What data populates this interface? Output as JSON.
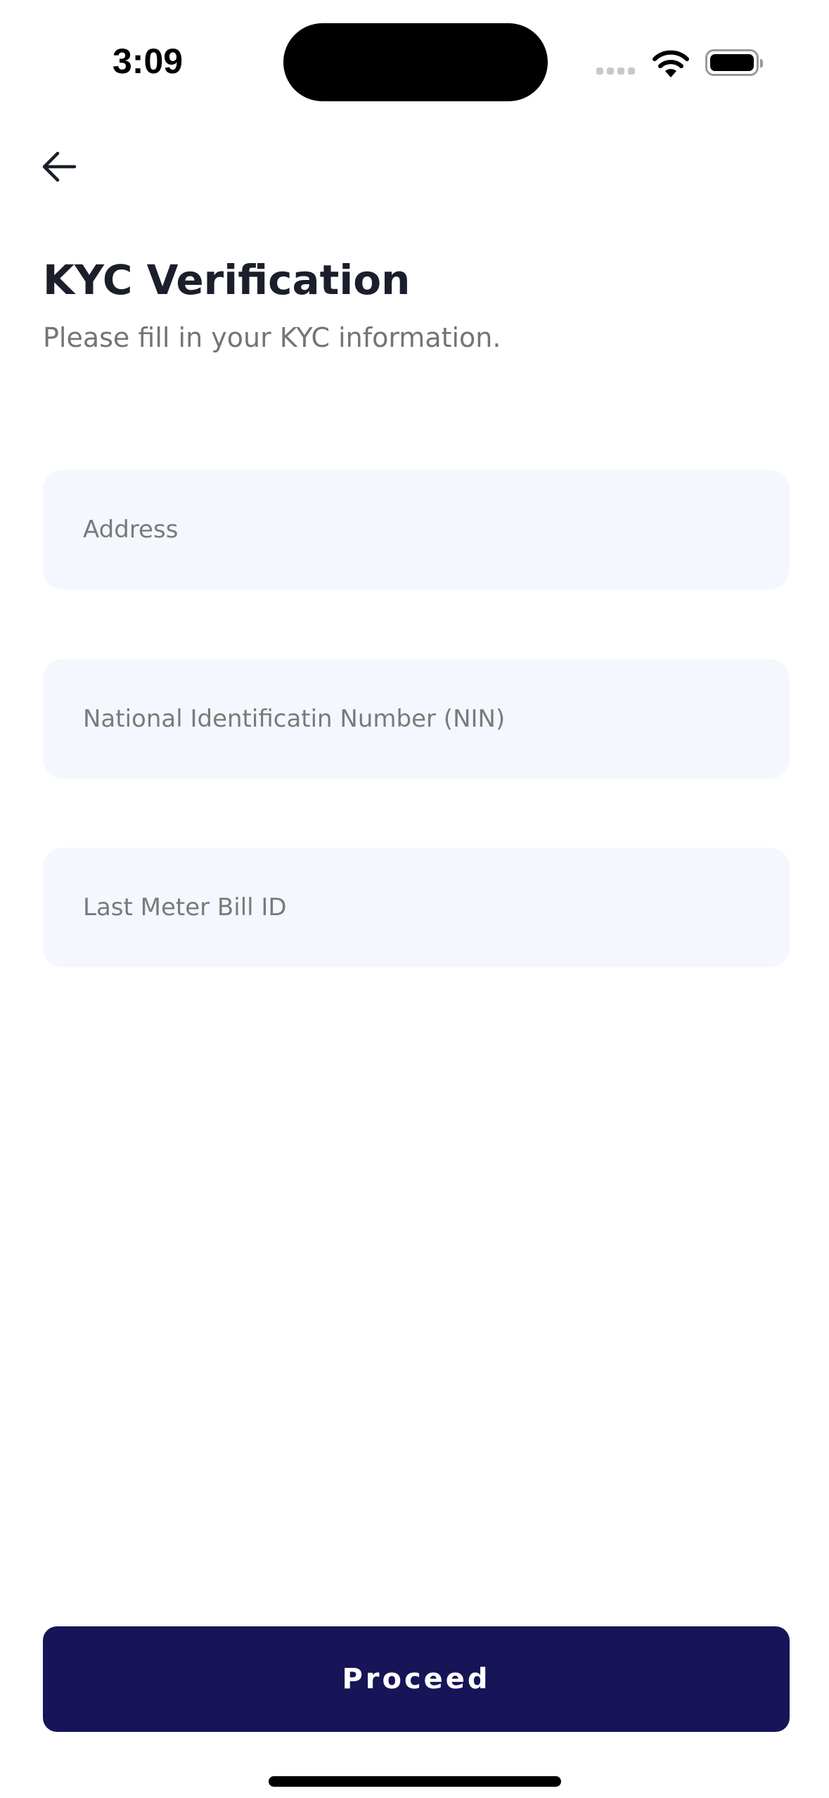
{
  "status_bar": {
    "time": "3:09",
    "icons": [
      "signal-icon",
      "wifi-icon",
      "battery-icon"
    ]
  },
  "header": {
    "back_icon": "arrow-left-icon",
    "title": "KYC Verification",
    "subtitle": "Please fill in your KYC information."
  },
  "form": {
    "fields": [
      {
        "placeholder": "Address",
        "value": ""
      },
      {
        "placeholder": "National Identificatin Number (NIN)",
        "value": ""
      },
      {
        "placeholder": "Last Meter Bill ID",
        "value": ""
      }
    ]
  },
  "actions": {
    "proceed_label": "Proceed"
  },
  "colors": {
    "primary": "#171457",
    "field_bg": "#f4f7fd",
    "title": "#1b1f2b",
    "subtitle": "#747474"
  }
}
